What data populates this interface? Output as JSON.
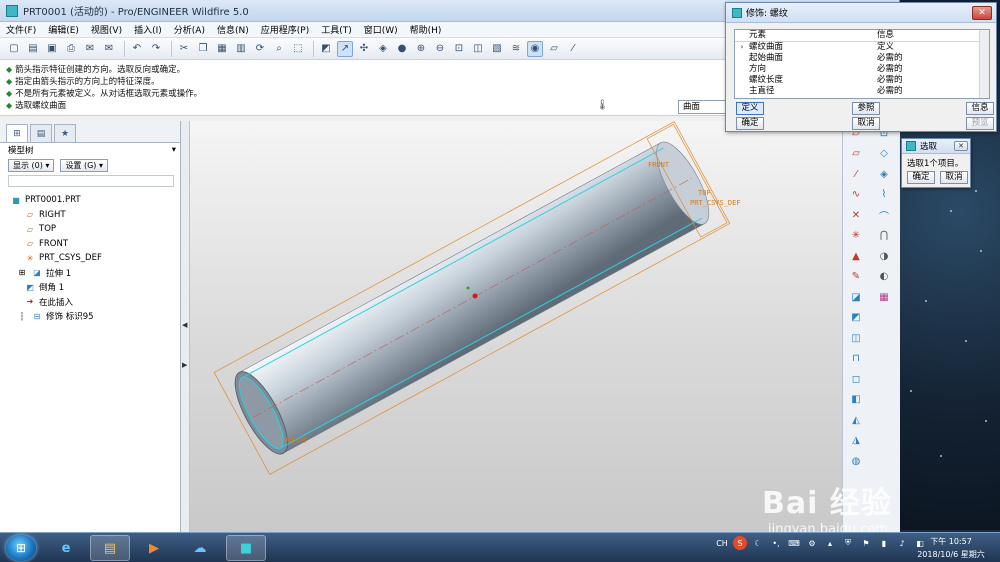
{
  "window": {
    "title": "PRT0001 (活动的) - Pro/ENGINEER Wildfire 5.0"
  },
  "menu": [
    "文件(F)",
    "编辑(E)",
    "视图(V)",
    "插入(I)",
    "分析(A)",
    "信息(N)",
    "应用程序(P)",
    "工具(T)",
    "窗口(W)",
    "帮助(H)"
  ],
  "toolbar_icons": [
    "new-icon",
    "open-icon",
    "save-icon",
    "print-icon",
    "email-icon",
    "email-link-icon",
    "undo-icon",
    "redo-icon",
    "cut-icon",
    "copy-icon",
    "paste-icon",
    "paste-special-icon",
    "regenerate-icon",
    "find-icon",
    "select-box-icon",
    "repaint-icon",
    "orient-icon",
    "spin-center-icon",
    "saved-views-icon",
    "shading-icon",
    "zoom-in-icon",
    "zoom-out-icon",
    "refit-icon",
    "reorient-icon",
    "view-manager-icon",
    "layers-icon",
    "display-style-icon",
    "datum-planes-icon",
    "datum-axes-icon"
  ],
  "messages": [
    "箭头指示特征创建的方向。选取反向或确定。",
    "指定由箭头指示的方向上的特征深度。",
    "不是所有元素被定义。从对话框选取元素或操作。",
    "选取螺纹曲面"
  ],
  "filter": {
    "value": "曲面"
  },
  "model_tree": {
    "header": "模型树",
    "display_button": "显示 (0)",
    "settings_button": "设置 (G)",
    "items": [
      {
        "label": "PRT0001.PRT",
        "icon": "part-icon",
        "indent": 0
      },
      {
        "label": "RIGHT",
        "icon": "datum-plane-icon",
        "indent": 1
      },
      {
        "label": "TOP",
        "icon": "datum-plane-icon",
        "indent": 1
      },
      {
        "label": "FRONT",
        "icon": "datum-plane-icon",
        "indent": 1
      },
      {
        "label": "PRT_CSYS_DEF",
        "icon": "csys-icon",
        "indent": 1
      },
      {
        "label": "拉伸 1",
        "icon": "extrude-icon",
        "indent": 2
      },
      {
        "label": "倒角 1",
        "icon": "chamfer-icon",
        "indent": 1
      },
      {
        "label": "在此插入",
        "icon": "insert-arrow-icon",
        "indent": 1
      },
      {
        "label": "修饰 标识95",
        "icon": "cosmetic-icon",
        "indent": 2
      }
    ]
  },
  "model_labels": {
    "front": "FRONT",
    "top": "TOP",
    "csys": "PRT_CSYS_DEF",
    "right": "RIGHT"
  },
  "thread_dialog": {
    "title": "修饰: 螺纹",
    "close": "✕",
    "col_element": "元素",
    "col_info": "信息",
    "rows": [
      {
        "element": "螺纹曲面",
        "info": "定义"
      },
      {
        "element": "起始曲面",
        "info": "必需的"
      },
      {
        "element": "方向",
        "info": "必需的"
      },
      {
        "element": "螺纹长度",
        "info": "必需的"
      },
      {
        "element": "主直径",
        "info": "必需的"
      }
    ],
    "buttons": {
      "define": "定义",
      "reference": "参照",
      "info": "信息",
      "ok": "确定",
      "cancel": "取消",
      "preview": "预览"
    }
  },
  "select_dialog": {
    "title": "选取",
    "message": "选取1个项目。",
    "ok": "确定",
    "cancel": "取消"
  },
  "taskbar": {
    "tray_ime": "CH",
    "time": "下午 10:57",
    "date": "2018/10/6 星期六"
  },
  "watermark": {
    "main": "Bai 经验",
    "sub": "jingyan.baidu.com"
  },
  "colors": {
    "accent": "#3b75c2",
    "model_edge": "#e08a2a",
    "selection_cyan": "#2fd0e0"
  }
}
